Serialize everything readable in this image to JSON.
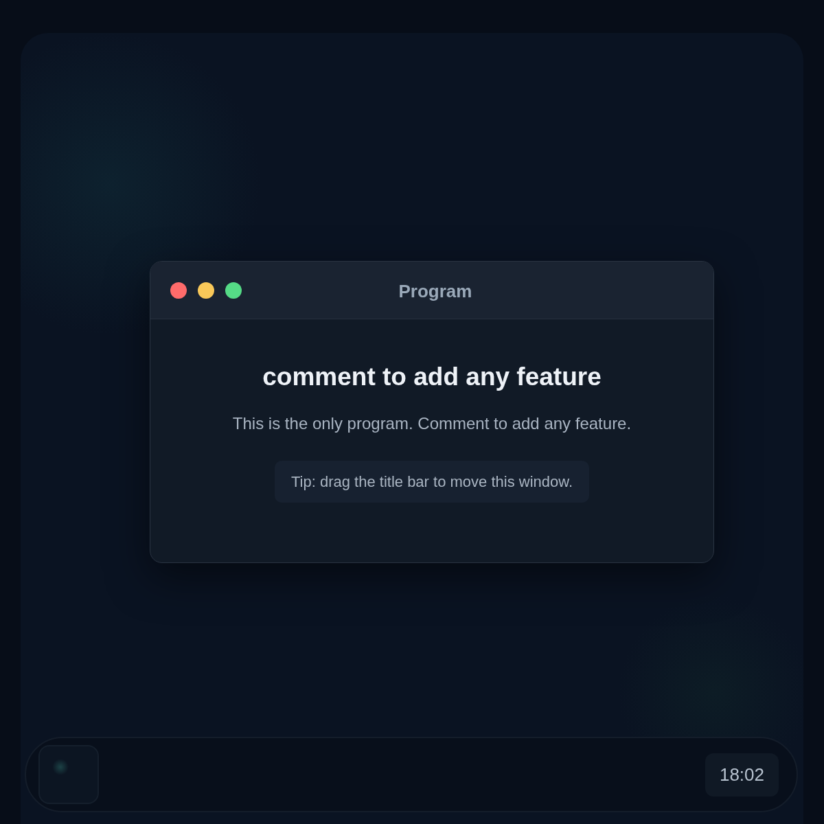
{
  "window": {
    "title": "Program",
    "controls": [
      {
        "color": "#ff6b6b"
      },
      {
        "color": "#f9c859"
      },
      {
        "color": "#55db86"
      }
    ],
    "heading": "comment to add any feature",
    "text": "This is the only program. Comment to add any feature.",
    "tip": "Tip: drag the title bar to move this window."
  },
  "taskbar": {
    "clock": "18:02"
  }
}
